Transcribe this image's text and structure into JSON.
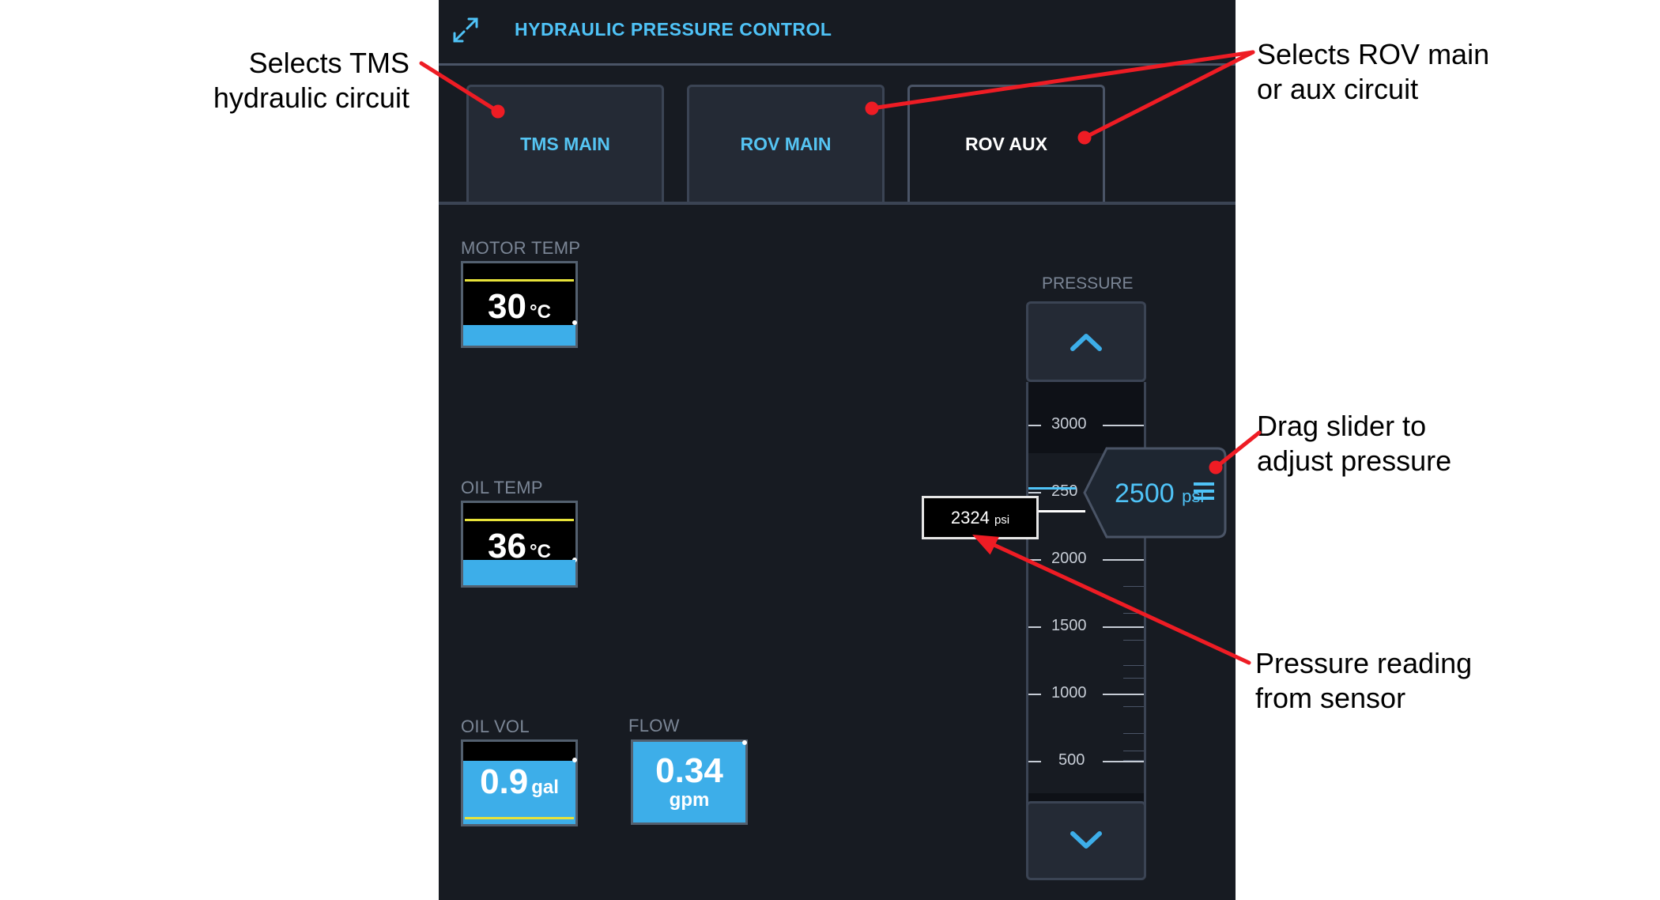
{
  "panel": {
    "title": "HYDRAULIC PRESSURE CONTROL",
    "tabs": [
      {
        "label": "TMS MAIN"
      },
      {
        "label": "ROV MAIN"
      },
      {
        "label": "ROV AUX"
      }
    ],
    "active_tab": "ROV AUX",
    "motor_temp": {
      "label": "MOTOR TEMP",
      "value": "30",
      "unit": "°C"
    },
    "oil_temp": {
      "label": "OIL TEMP",
      "value": "36",
      "unit": "°C"
    },
    "oil_vol": {
      "label": "OIL VOL",
      "value": "0.9",
      "unit": "gal"
    },
    "flow": {
      "label": "FLOW",
      "value": "0.34",
      "unit": "gpm"
    },
    "pressure": {
      "label": "PRESSURE",
      "scale_labels": [
        "3000",
        "250",
        "2000",
        "1500",
        "1000",
        "500"
      ],
      "setpoint_value": "2500",
      "setpoint_unit": "psi",
      "reading_value": "2324",
      "reading_unit": "psi"
    }
  },
  "callouts": {
    "tms": [
      "Selects TMS",
      "hydraulic circuit"
    ],
    "rov": [
      "Selects ROV main",
      "or aux circuit"
    ],
    "slider": [
      "Drag slider to",
      "adjust pressure"
    ],
    "reading": [
      "Pressure reading",
      "from sensor"
    ]
  },
  "colors": {
    "panel_bg": "#171b22",
    "accent_blue": "#4fc3f7",
    "fill_blue": "#3daee9",
    "level_yellow": "#e8e33a",
    "annotation_red": "#ee1c24"
  }
}
